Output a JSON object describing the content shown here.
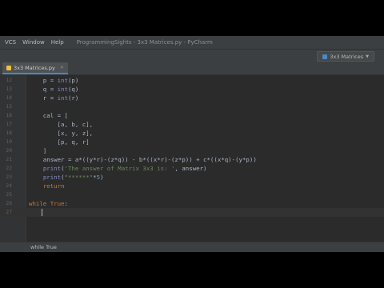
{
  "menubar": {
    "items": [
      "VCS",
      "Window",
      "Help"
    ],
    "window_title": "ProgrammingSights - 3x3 Matrices.py - PyCharm"
  },
  "toolbar": {
    "run_config": "3x3 Matrices"
  },
  "editor_tab": {
    "label": "3x3 Matrices.py"
  },
  "code": {
    "lines": [
      {
        "n": "12",
        "text": "    p = int(p)"
      },
      {
        "n": "13",
        "text": "    q = int(q)"
      },
      {
        "n": "14",
        "text": "    r = int(r)"
      },
      {
        "n": "15",
        "text": ""
      },
      {
        "n": "16",
        "text": "    cal = ["
      },
      {
        "n": "17",
        "text": "        [a, b, c],"
      },
      {
        "n": "18",
        "text": "        [x, y, z],"
      },
      {
        "n": "19",
        "text": "        [p, q, r]"
      },
      {
        "n": "20",
        "text": "    ]"
      },
      {
        "n": "21",
        "text": "    answer = a*((y*r)-(z*q)) - b*((x*r)-(z*p)) + c*((x*q)-(y*p))"
      },
      {
        "n": "22",
        "text": "    print('The answer of Matrix 3x3 is: ', answer)"
      },
      {
        "n": "23",
        "text": "    print(\"******\"*5)"
      },
      {
        "n": "24",
        "text": "    return"
      },
      {
        "n": "25",
        "text": ""
      },
      {
        "n": "26",
        "text": "while True:"
      },
      {
        "n": "27",
        "text": ""
      }
    ]
  },
  "statusbar": {
    "breadcrumb": "while True"
  }
}
